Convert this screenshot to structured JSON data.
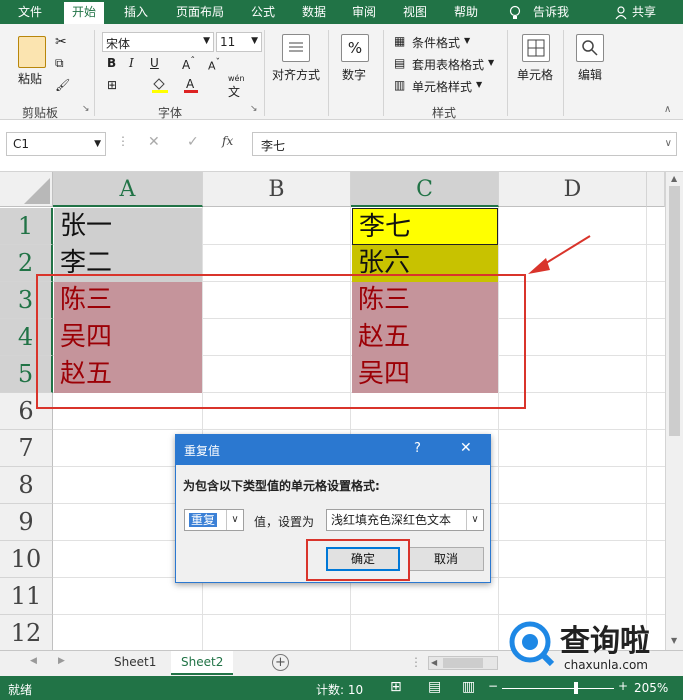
{
  "menu": {
    "items": [
      "文件",
      "开始",
      "插入",
      "页面布局",
      "公式",
      "数据",
      "审阅",
      "视图",
      "帮助"
    ],
    "tell_me": "告诉我",
    "share": "共享"
  },
  "ribbon": {
    "clipboard": {
      "paste": "粘贴",
      "label": "剪贴板"
    },
    "font": {
      "name": "宋体",
      "size": "11",
      "bold": "B",
      "italic": "I",
      "underline": "U",
      "label": "字体",
      "wen": "wén",
      "wen_char": "文"
    },
    "alignment": {
      "label": "对齐方式"
    },
    "number": {
      "label": "数字",
      "percent": "%"
    },
    "styles": {
      "conditional": "条件格式",
      "table": "套用表格格式",
      "cell_style": "单元格样式",
      "label": "样式"
    },
    "cells": {
      "label": "单元格"
    },
    "editing": {
      "label": "编辑"
    }
  },
  "formula_bar": {
    "name_box": "C1",
    "fx": "fx",
    "value": "李七"
  },
  "grid": {
    "columns": [
      "A",
      "B",
      "C",
      "D"
    ],
    "rows": [
      "1",
      "2",
      "3",
      "4",
      "5",
      "6",
      "7",
      "8",
      "9",
      "10",
      "11",
      "12"
    ],
    "col_a": [
      "张一",
      "李二",
      "陈三",
      "吴四",
      "赵五"
    ],
    "col_c": [
      "李七",
      "张六",
      "陈三",
      "赵五",
      "吴四"
    ]
  },
  "dialog": {
    "title": "重复值",
    "help": "?",
    "close": "✕",
    "prompt": "为包含以下类型值的单元格设置格式:",
    "type_value": "重复",
    "middle_text": "值，设置为",
    "format_value": "浅红填充色深红色文本",
    "ok": "确定",
    "cancel": "取消"
  },
  "sheets": {
    "tabs": [
      "Sheet1",
      "Sheet2"
    ],
    "add": "+"
  },
  "status": {
    "ready": "就绪",
    "count": "计数: 10",
    "zoom": "205%"
  },
  "watermark": {
    "brand": "查询啦",
    "url": "chaxunla.com"
  },
  "colors": {
    "excel_green": "#217346",
    "duplicate_fill": "#c5949b",
    "duplicate_text": "#9c0006",
    "highlight_red": "#d9342b"
  }
}
